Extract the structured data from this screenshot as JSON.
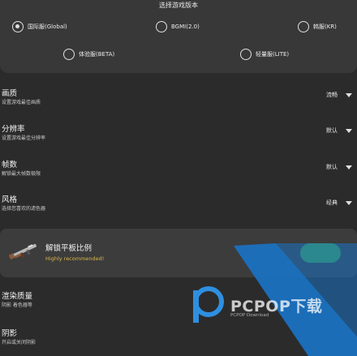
{
  "version_select": {
    "title": "选择游戏版本",
    "options": [
      {
        "label": "国际服(Global)",
        "checked": true
      },
      {
        "label": "BGMI(2.0)",
        "checked": false
      },
      {
        "label": "韩服(KR)",
        "checked": false
      },
      {
        "label": "体验服(BETA)",
        "checked": false
      },
      {
        "label": "轻量服(LITE)",
        "checked": false
      }
    ]
  },
  "settings": [
    {
      "title": "画质",
      "desc": "设置游戏最佳画质",
      "value": "流畅"
    },
    {
      "title": "分辨率",
      "desc": "设置游戏最佳分辨率",
      "value": "默认"
    },
    {
      "title": "帧数",
      "desc": "解锁最大帧数极限",
      "value": "默认"
    },
    {
      "title": "风格",
      "desc": "选择您喜欢的滤色器",
      "value": "经典"
    }
  ],
  "unlock": {
    "title": "解锁平板比例",
    "subtitle": "Highly recommended!",
    "toggle_on": true
  },
  "render_quality": {
    "title": "渲染质量",
    "desc": "阴影 着色器等"
  },
  "shadow": {
    "title": "阴影",
    "desc": "开启或关闭阴影"
  },
  "watermark": {
    "text": "PCPOP下载",
    "sub": "PCPOP Download"
  },
  "colors": {
    "background": "#2b2b2b",
    "card": "#383838",
    "toggle_on": "#3fa34d",
    "accent_text": "#d8b74a",
    "watermark_blue": "#1a73c4"
  }
}
